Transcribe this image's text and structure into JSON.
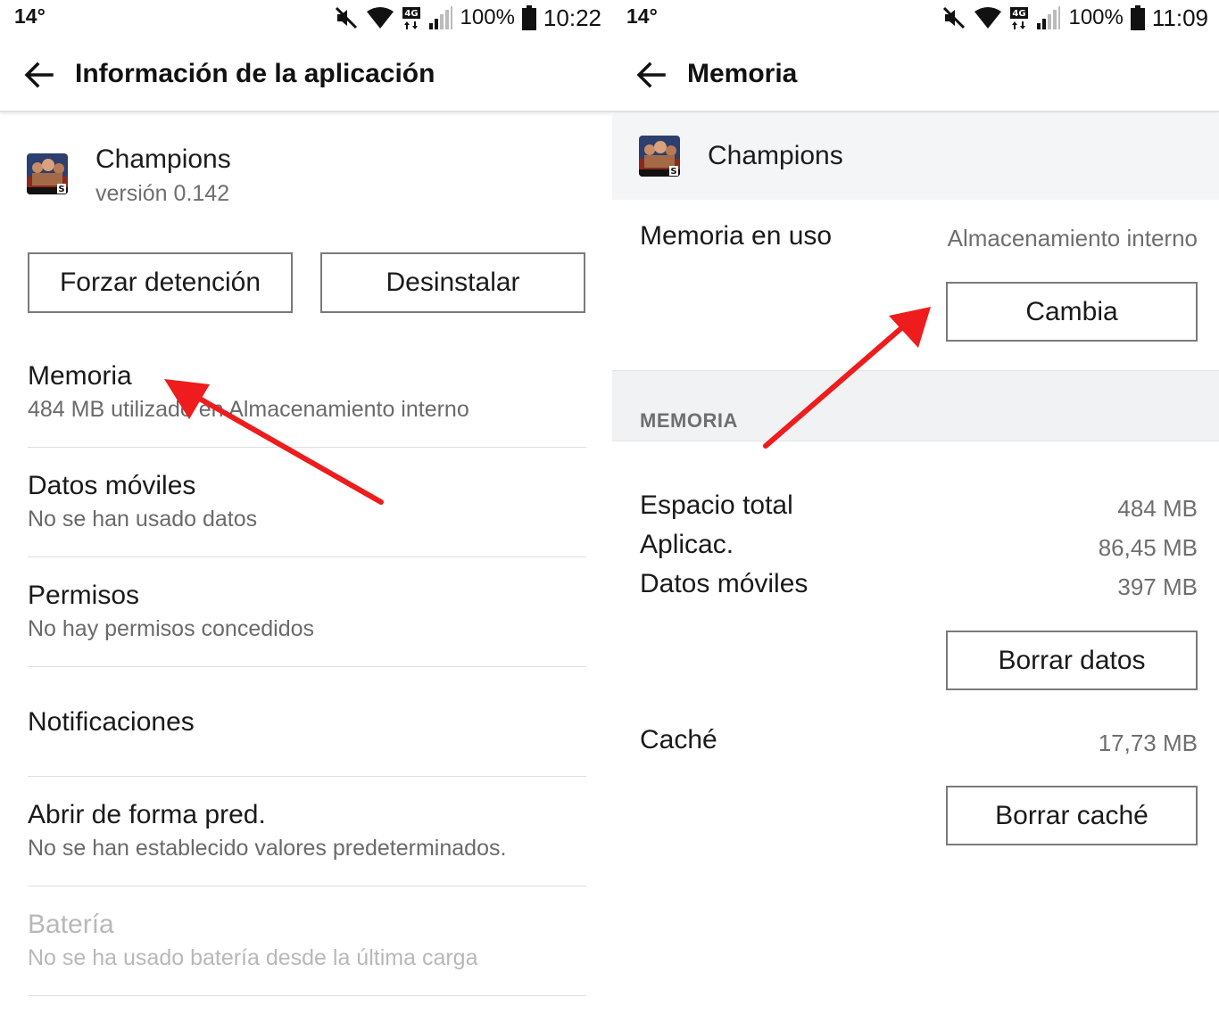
{
  "left": {
    "status": {
      "temp": "14°",
      "battery": "100%",
      "time": "10:22"
    },
    "toolbar": {
      "title": "Información de la aplicación"
    },
    "app": {
      "name": "Champions",
      "version": "versión 0.142"
    },
    "buttons": {
      "force_stop": "Forzar detención",
      "uninstall": "Desinstalar"
    },
    "items": [
      {
        "title": "Memoria",
        "subtitle": "484 MB utilizado en Almacenamiento interno"
      },
      {
        "title": "Datos móviles",
        "subtitle": "No se han usado datos"
      },
      {
        "title": "Permisos",
        "subtitle": "No hay permisos concedidos"
      },
      {
        "title": "Notificaciones",
        "subtitle": ""
      },
      {
        "title": "Abrir de forma pred.",
        "subtitle": "No se han establecido valores predeterminados."
      },
      {
        "title": "Batería",
        "subtitle": "No se ha usado batería desde la última carga"
      }
    ]
  },
  "right": {
    "status": {
      "temp": "14°",
      "battery": "100%",
      "time": "11:09"
    },
    "toolbar": {
      "title": "Memoria"
    },
    "app": {
      "name": "Champions"
    },
    "storage_used": {
      "label": "Memoria en uso",
      "value": "Almacenamiento interno",
      "button": "Cambia"
    },
    "section_title": "MEMORIA",
    "rows": [
      {
        "label": "Espacio total",
        "value": "484 MB"
      },
      {
        "label": "Aplicac.",
        "value": "86,45 MB"
      },
      {
        "label": "Datos móviles",
        "value": "397 MB"
      }
    ],
    "clear_data_button": "Borrar datos",
    "cache": {
      "label": "Caché",
      "value": "17,73 MB"
    },
    "clear_cache_button": "Borrar caché"
  },
  "colors": {
    "arrow": "#ee1c1c",
    "text": "#1a1a1a",
    "secondary": "#6e6e6e",
    "section_bg": "#f1f2f4"
  },
  "icons": [
    "back-arrow-icon",
    "mute-icon",
    "wifi-icon",
    "4g-icon",
    "signal-icon",
    "battery-icon",
    "app-icon"
  ]
}
